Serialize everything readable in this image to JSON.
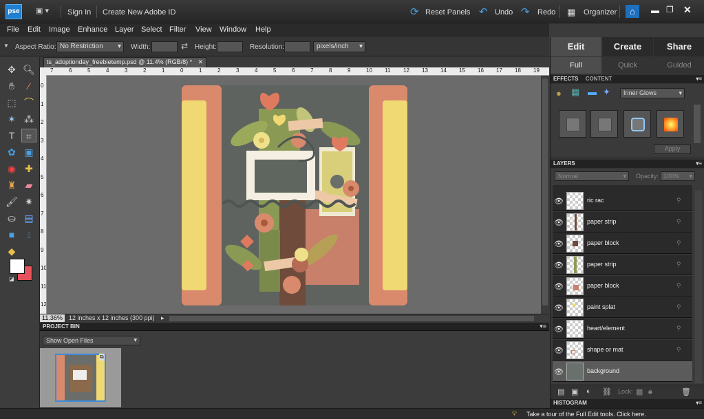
{
  "titlebar": {
    "logo": "pse",
    "sign_in": "Sign In",
    "create_id": "Create New Adobe ID",
    "reset_panels": "Reset Panels",
    "undo": "Undo",
    "redo": "Redo",
    "organizer": "Organizer"
  },
  "menu": [
    "File",
    "Edit",
    "Image",
    "Enhance",
    "Layer",
    "Select",
    "Filter",
    "View",
    "Window",
    "Help"
  ],
  "options": {
    "aspect_label": "Aspect Ratio:",
    "aspect_value": "No Restriction",
    "width_label": "Width:",
    "height_label": "Height:",
    "resolution_label": "Resolution:",
    "resolution_unit": "pixels/inch"
  },
  "document": {
    "tab_title": "ts_adoptionday_freebietemp.psd @ 11.4% (RGB/8) *",
    "ruler_top": [
      "7",
      "6",
      "5",
      "4",
      "3",
      "2",
      "1",
      "0",
      "1",
      "2",
      "3",
      "4",
      "5",
      "6",
      "7",
      "8",
      "9",
      "10",
      "11",
      "12",
      "13",
      "14",
      "15",
      "16",
      "17",
      "18",
      "19"
    ],
    "ruler_left": [
      "0",
      "1",
      "2",
      "3",
      "4",
      "5",
      "6",
      "7",
      "8",
      "9",
      "10",
      "11",
      "12"
    ],
    "zoom": "11.36%",
    "doc_info": "12 inches x 12 inches (300 ppi)"
  },
  "project_bin": {
    "title": "PROJECT BIN",
    "show": "Show Open Files"
  },
  "right_panel": {
    "modes": [
      "Edit",
      "Create",
      "Share"
    ],
    "submodes": [
      "Full",
      "Quick",
      "Guided"
    ],
    "effects_tab": "EFFECTS",
    "content_tab": "CONTENT",
    "effect_filter": "Inner Glows",
    "apply": "Apply",
    "layers_title": "LAYERS",
    "blend_mode": "Normal",
    "opacity_label": "Opacity:",
    "opacity_value": "100%",
    "lock_label": "Lock:",
    "histogram_title": "HISTOGRAM",
    "layers": [
      {
        "name": "ric rac",
        "selected": false
      },
      {
        "name": "paper strip",
        "selected": false
      },
      {
        "name": "paper block",
        "selected": false
      },
      {
        "name": "paper strip",
        "selected": false
      },
      {
        "name": "paper block",
        "selected": false
      },
      {
        "name": "paint splat",
        "selected": false
      },
      {
        "name": "heart/element",
        "selected": false
      },
      {
        "name": "shape or mat",
        "selected": false
      },
      {
        "name": "background",
        "selected": true
      }
    ]
  },
  "statusbar": {
    "tour": "Take a tour of the Full Edit tools. Click here."
  },
  "colors": {
    "foreground": "#ffffff",
    "background": "#e8525a",
    "accent": "#1f7fd1",
    "peach": "#d98a6c",
    "yellow": "#f0d873",
    "sage": "#8a9a55"
  }
}
